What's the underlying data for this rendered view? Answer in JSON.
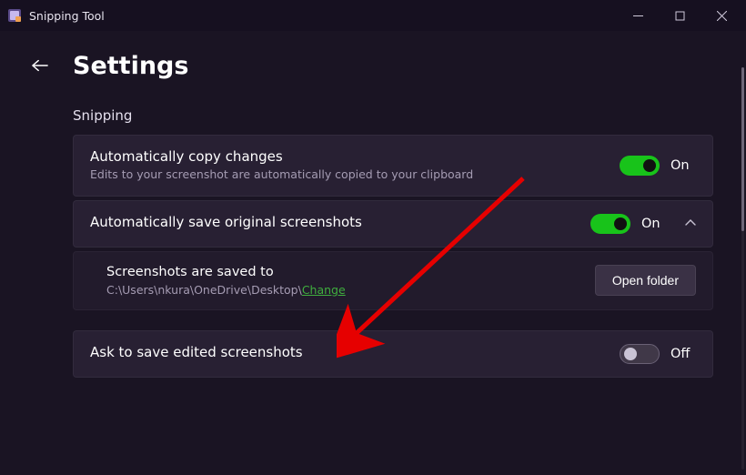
{
  "titlebar": {
    "app_name": "Snipping Tool"
  },
  "header": {
    "page_title": "Settings"
  },
  "section": {
    "label": "Snipping"
  },
  "settings": {
    "auto_copy": {
      "title": "Automatically copy changes",
      "subtitle": "Edits to your screenshot are automatically copied to your clipboard",
      "state_label": "On",
      "on": true
    },
    "auto_save": {
      "title": "Automatically save original screenshots",
      "state_label": "On",
      "on": true,
      "expanded": true,
      "sub": {
        "title": "Screenshots are saved to",
        "path": "C:\\Users\\nkura\\OneDrive\\Desktop\\",
        "change_label": "Change",
        "open_button": "Open folder"
      }
    },
    "ask_save": {
      "title": "Ask to save edited screenshots",
      "state_label": "Off",
      "on": false
    }
  }
}
